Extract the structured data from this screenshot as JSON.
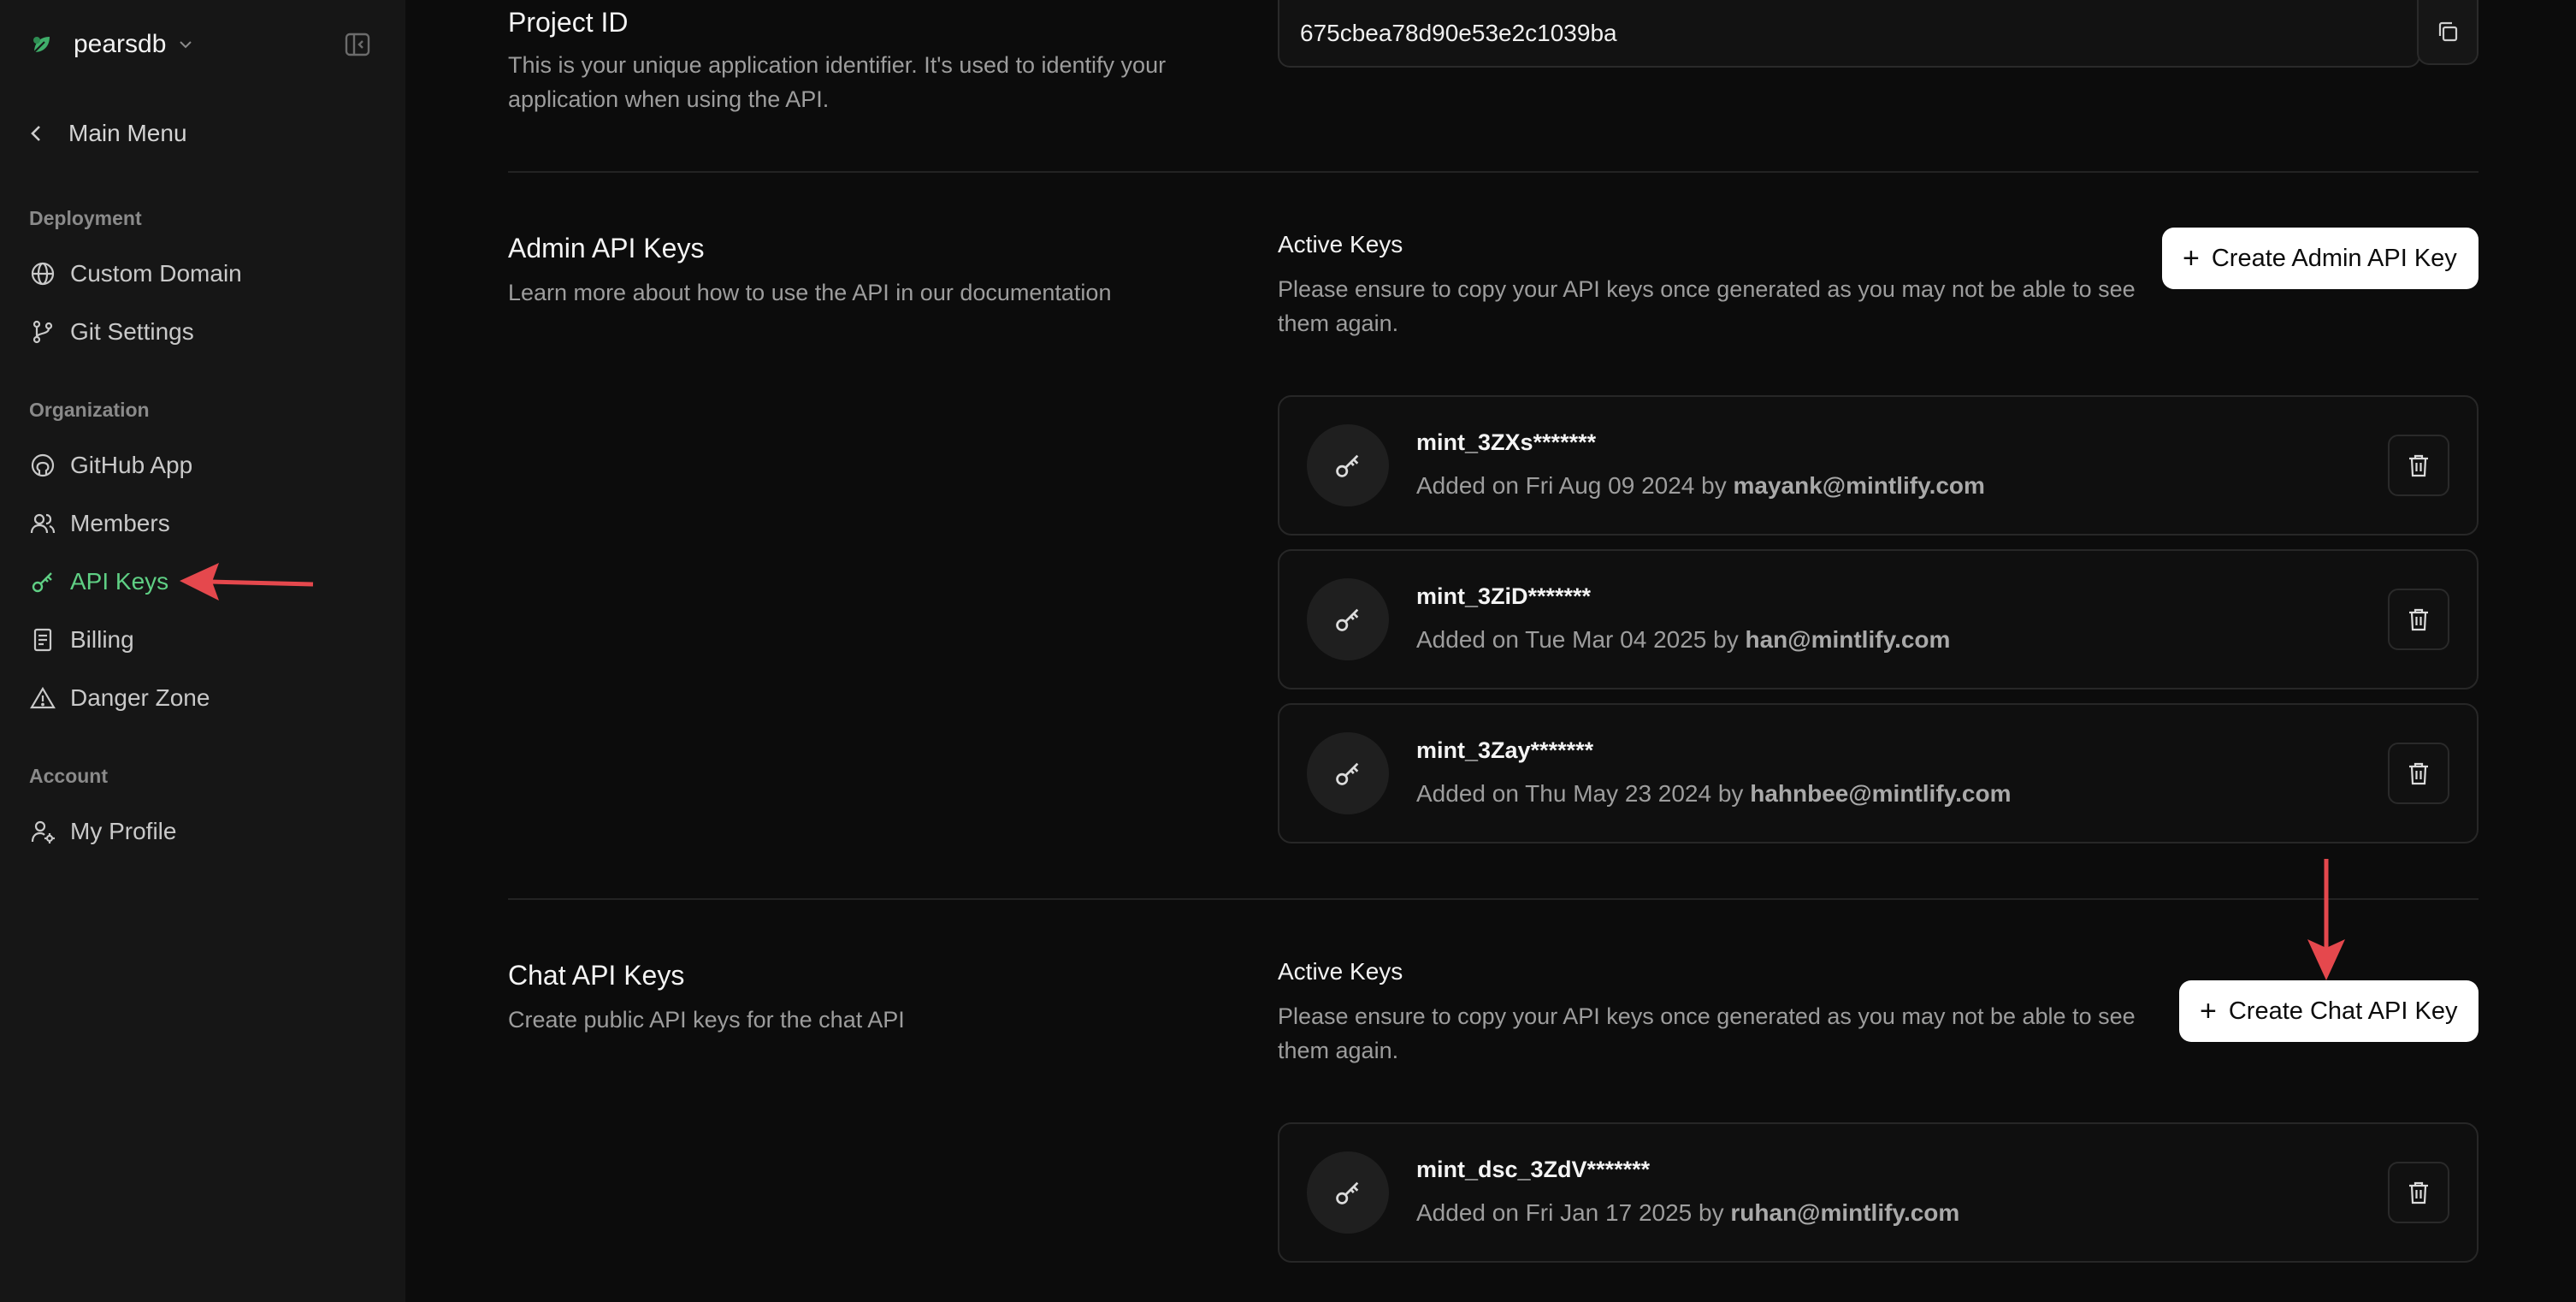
{
  "sidebar": {
    "org_name": "pearsdb",
    "back_label": "Main Menu",
    "sections": {
      "deployment": "Deployment",
      "organization": "Organization",
      "account": "Account"
    },
    "items": {
      "custom_domain": "Custom Domain",
      "git_settings": "Git Settings",
      "github_app": "GitHub App",
      "members": "Members",
      "api_keys": "API Keys",
      "billing": "Billing",
      "danger_zone": "Danger Zone",
      "my_profile": "My Profile"
    },
    "active_color": "#5fcf84"
  },
  "project": {
    "title": "Project ID",
    "description": "This is your unique application identifier. It's used to identify your application when using the API.",
    "id_value": "675cbea78d90e53e2c1039ba"
  },
  "admin_keys": {
    "title": "Admin API Keys",
    "description": "Learn more about how to use the API in our documentation",
    "active_title": "Active Keys",
    "active_desc": "Please ensure to copy your API keys once generated as you may not be able to see them again.",
    "create_label": "Create Admin API Key",
    "keys": [
      {
        "name": "mint_3ZXs*******",
        "added": "Added on Fri Aug 09 2024 by",
        "by": "mayank@mintlify.com"
      },
      {
        "name": "mint_3ZiD*******",
        "added": "Added on Tue Mar 04 2025 by",
        "by": "han@mintlify.com"
      },
      {
        "name": "mint_3Zay*******",
        "added": "Added on Thu May 23 2024 by",
        "by": "hahnbee@mintlify.com"
      }
    ]
  },
  "chat_keys": {
    "title": "Chat API Keys",
    "description": "Create public API keys for the chat API",
    "active_title": "Active Keys",
    "active_desc": "Please ensure to copy your API keys once generated as you may not be able to see them again.",
    "create_label": "Create Chat API Key",
    "keys": [
      {
        "name": "mint_dsc_3ZdV*******",
        "added": "Added on Fri Jan 17 2025 by",
        "by": "ruhan@mintlify.com"
      }
    ]
  },
  "annotation_color": "#e5484d"
}
